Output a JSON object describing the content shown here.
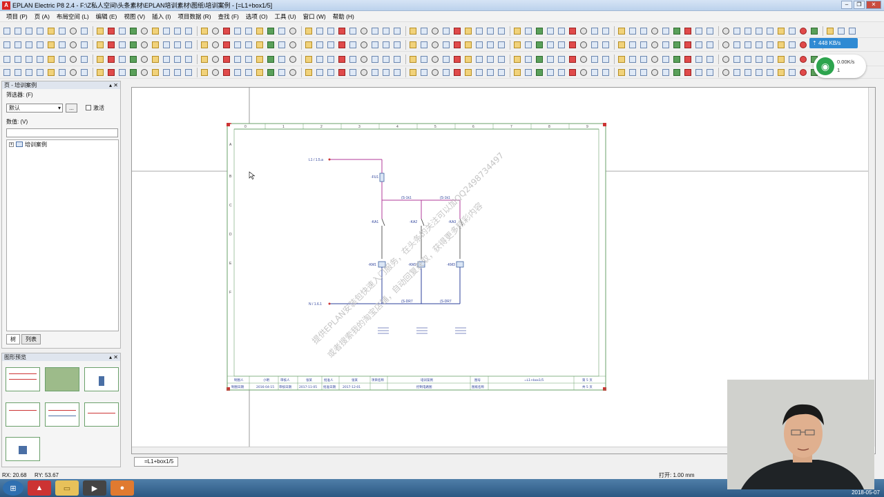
{
  "window": {
    "title": "EPLAN Electric P8 2.4 - F:\\Z私人空间\\头条素材\\EPLAN培训素材\\图纸\\培训案例 - [=L1+box1/5]",
    "logo": "A"
  },
  "menu": [
    "项目 (P)",
    "页 (A)",
    "布局空间 (L)",
    "编辑 (E)",
    "视图 (V)",
    "插入 (I)",
    "项目数据 (R)",
    "查找 (F)",
    "选项 (O)",
    "工具 (U)",
    "窗口 (W)",
    "帮助 (H)"
  ],
  "network": {
    "speed_badge": "448 KB/s",
    "rate": "0.00K/s",
    "count": "1"
  },
  "page_panel": {
    "title": "页 - 培训案例",
    "filter_label": "筛选器: (F)",
    "filter_value": "默认",
    "ellipsis": "...",
    "activate_label": "激活",
    "value_label": "数值: (V)",
    "tree_root": "培训案例",
    "tab_tree": "树",
    "tab_list": "列表"
  },
  "preview_panel": {
    "title": "图形预览"
  },
  "drawing": {
    "col_numbers": [
      "0",
      "1",
      "2",
      "3",
      "4",
      "5",
      "6",
      "7",
      "8",
      "9"
    ],
    "row_letters": [
      "A",
      "B",
      "C",
      "D",
      "E",
      "F"
    ],
    "l1_ref": "L1 / 1.5.a",
    "n_ref": "N / 1.6.1",
    "fuse": "-FU1",
    "wire_top_labels": [
      "(S-1k1",
      "(S-1k1"
    ],
    "contacts": [
      "-KA1",
      "-KA2",
      "-KA3"
    ],
    "coils": [
      "-KM1",
      "-KM2",
      "-KM3"
    ],
    "wire_bottom_labels": [
      "(S-DR7",
      "(S-DR7"
    ],
    "watermark_1": "提供EPLAN安装包快速入门服务，在头条的关注可以加QQ2498734497",
    "watermark_2": "或者搜索我的淘宝店铺，自动回复获取，获得更多精彩内容",
    "title_block_row1": [
      "制图人",
      "小明",
      "审核人",
      "张某",
      "批准人",
      "张某",
      "项目名称",
      "培训案例",
      "图号",
      "=L1+box1/5",
      "第 5 页"
    ],
    "title_block_row2": [
      "制图日期",
      "2016-04-15",
      "审核日期",
      "2017-11-05",
      "批准日期",
      "2017-12-01",
      "",
      "控制电路图",
      "图纸名称",
      "",
      "共 5 页"
    ]
  },
  "doc_tab": "=L1+box1/5",
  "status": {
    "rx": "RX: 20.68",
    "ry": "RY: 53.67",
    "grid": "打开: 1.00 mm"
  },
  "clock": "2018-05-07"
}
